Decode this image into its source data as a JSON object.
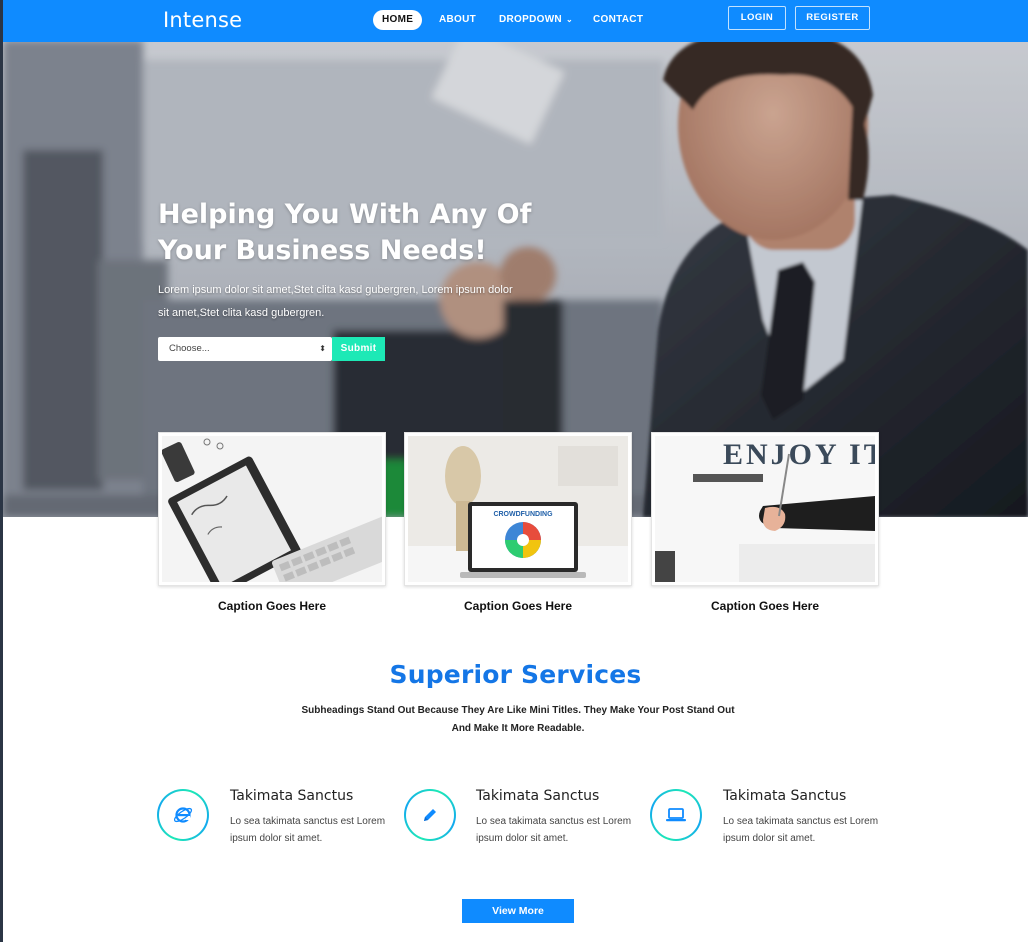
{
  "navbar": {
    "brand": "Intense",
    "links": [
      "HOME",
      "ABOUT",
      "DROPDOWN",
      "CONTACT"
    ],
    "dropdown_caret": "⌄",
    "login": "LOGIN",
    "register": "REGISTER"
  },
  "hero": {
    "title_line1": "Helping You With Any Of",
    "title_line2": "Your Business Needs!",
    "text_line1": "Lorem ipsum dolor sit amet,Stet clita kasd gubergren, Lorem ipsum dolor",
    "text_line2": "sit amet,Stet clita kasd gubergren.",
    "select_value": "Choose...",
    "submit": "Submit"
  },
  "cards": [
    {
      "caption": "Caption Goes Here",
      "image_text": ""
    },
    {
      "caption": "Caption Goes Here",
      "image_text": "CROWDFUNDING"
    },
    {
      "caption": "Caption Goes Here",
      "image_text": "ENJOY IT"
    }
  ],
  "services": {
    "title": "Superior Services",
    "subtitle_line1": "Subheadings Stand Out Because They Are Like Mini Titles. They Make Your Post Stand Out",
    "subtitle_line2": "And Make It More Readable.",
    "items": [
      {
        "icon": "internet-explorer-icon",
        "title": "Takimata Sanctus",
        "text_line1": "Lo sea takimata sanctus est Lorem",
        "text_line2": "ipsum dolor sit amet."
      },
      {
        "icon": "pencil-icon",
        "title": "Takimata Sanctus",
        "text_line1": "Lo sea takimata sanctus est Lorem",
        "text_line2": "ipsum dolor sit amet."
      },
      {
        "icon": "laptop-icon",
        "title": "Takimata Sanctus",
        "text_line1": "Lo sea takimata sanctus est Lorem",
        "text_line2": "ipsum dolor sit amet."
      }
    ],
    "view_more": "View More"
  },
  "colors": {
    "primary": "#0f8bff",
    "accent": "#1de9b6",
    "title_blue": "#1476e6"
  }
}
